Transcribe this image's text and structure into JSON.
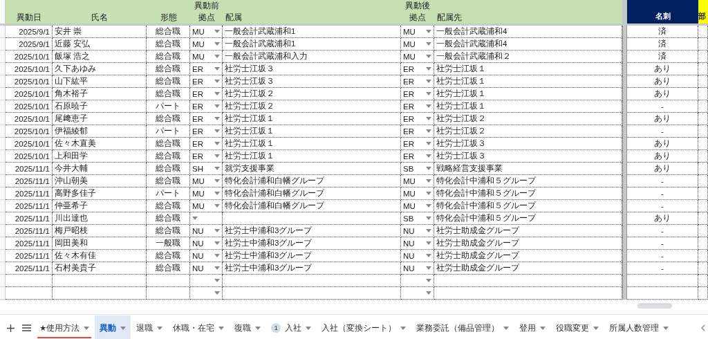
{
  "header": {
    "group_before": "異動前",
    "group_after": "異動後",
    "columns": [
      "異動日",
      "氏名",
      "形態",
      "拠点",
      "配属",
      "拠点",
      "配属先"
    ],
    "card_column": "名刺",
    "cut_column": "部"
  },
  "rows": [
    {
      "date": "2025/9/1",
      "name": "安井 崇",
      "type": "総合職",
      "before_site": "MU",
      "before_dept": "一般会計武蔵浦和1",
      "after_site": "MU",
      "after_dept": "一般会計武蔵浦和4",
      "card": "済"
    },
    {
      "date": "2025/9/1",
      "name": "近藤 安弘",
      "type": "総合職",
      "before_site": "MU",
      "before_dept": "一般会計武蔵浦和1",
      "after_site": "MU",
      "after_dept": "一般会計武蔵浦和4",
      "card": "済"
    },
    {
      "date": "2025/10/1",
      "name": "飯塚 浩之",
      "type": "総合職",
      "before_site": "MU",
      "before_dept": "一般会計武蔵浦和入力",
      "after_site": "MU",
      "after_dept": "一般会計武蔵浦和２",
      "card": "済"
    },
    {
      "date": "2025/10/1",
      "name": "久下あゆみ",
      "type": "総合職",
      "before_site": "ER",
      "before_dept": "社労士江坂３",
      "after_site": "ER",
      "after_dept": "社労士江坂１",
      "card": "あり"
    },
    {
      "date": "2025/10/1",
      "name": "山下紘平",
      "type": "総合職",
      "before_site": "ER",
      "before_dept": "社労士江坂３",
      "after_site": "ER",
      "after_dept": "社労士江坂１",
      "card": "あり"
    },
    {
      "date": "2025/10/1",
      "name": "角木裕子",
      "type": "総合職",
      "before_site": "ER",
      "before_dept": "社労士江坂２",
      "after_site": "ER",
      "after_dept": "社労士江坂１",
      "card": "あり"
    },
    {
      "date": "2025/10/1",
      "name": "石原暁子",
      "type": "パート",
      "before_site": "ER",
      "before_dept": "社労士江坂２",
      "after_site": "ER",
      "after_dept": "社労士江坂１",
      "card": "-"
    },
    {
      "date": "2025/10/1",
      "name": "尾﨑恵子",
      "type": "総合職",
      "before_site": "ER",
      "before_dept": "社労士江坂１",
      "after_site": "ER",
      "after_dept": "社労士江坂２",
      "card": "あり"
    },
    {
      "date": "2025/10/1",
      "name": "伊福綾郁",
      "type": "パート",
      "before_site": "ER",
      "before_dept": "社労士江坂１",
      "after_site": "ER",
      "after_dept": "社労士江坂２",
      "card": "-"
    },
    {
      "date": "2025/10/1",
      "name": "佐々木直美",
      "type": "総合職",
      "before_site": "ER",
      "before_dept": "社労士江坂１",
      "after_site": "ER",
      "after_dept": "社労士江坂３",
      "card": "あり"
    },
    {
      "date": "2025/10/1",
      "name": "上和田学",
      "type": "総合職",
      "before_site": "ER",
      "before_dept": "社労士江坂１",
      "after_site": "ER",
      "after_dept": "社労士江坂３",
      "card": "あり"
    },
    {
      "date": "2025/11/1",
      "name": "今井大輔",
      "type": "総合職",
      "before_site": "SH",
      "before_dept": "就労支援事業",
      "after_site": "SB",
      "after_dept": "戦略経営支援事業",
      "card": "あり"
    },
    {
      "date": "2025/11/1",
      "name": "沖山朝美",
      "type": "総合職",
      "before_site": "MU",
      "before_dept": "特化会計浦和白幡グループ",
      "after_site": "MU",
      "after_dept": "特化会計中浦和５グループ",
      "card": "-"
    },
    {
      "date": "2025/11/1",
      "name": "高野多佳子",
      "type": "パート",
      "before_site": "MU",
      "before_dept": "特化会計浦和白幡グループ",
      "after_site": "MU",
      "after_dept": "特化会計中浦和５グループ",
      "card": "-"
    },
    {
      "date": "2025/11/1",
      "name": "仲亜希子",
      "type": "総合職",
      "before_site": "MU",
      "before_dept": "特化会計浦和白幡グループ",
      "after_site": "MU",
      "after_dept": "特化会計中浦和５グループ",
      "card": "-"
    },
    {
      "date": "2025/11/1",
      "name": "川出達也",
      "type": "総合職",
      "after_site": "SB",
      "after_dept": "特化会計中浦和５グループ",
      "card": "あり"
    },
    {
      "date": "2025/11/1",
      "name": "梅戸昭枝",
      "type": "総合職",
      "before_site": "NU",
      "before_dept": "社労士中浦和3グループ",
      "after_site": "NU",
      "after_dept": "社労士助成金グループ",
      "card": "-"
    },
    {
      "date": "2025/11/1",
      "name": "岡田美和",
      "type": "一般職",
      "before_site": "NU",
      "before_dept": "社労士中浦和3グループ",
      "after_site": "NU",
      "after_dept": "社労士助成金グループ",
      "card": "-"
    },
    {
      "date": "2025/11/1",
      "name": "佐々木有佳",
      "type": "総合職",
      "before_site": "NU",
      "before_dept": "社労士中浦和3グループ",
      "after_site": "NU",
      "after_dept": "社労士助成金グループ",
      "card": "-"
    },
    {
      "date": "2025/11/1",
      "name": "石村美貴子",
      "type": "総合職",
      "before_site": "NU",
      "before_dept": "社労士中浦和3グループ",
      "after_site": "NU",
      "after_dept": "社労士助成金グループ",
      "card": "-"
    }
  ],
  "tabs": [
    {
      "label": "★使用方法",
      "selected": false,
      "color": "#ea4335"
    },
    {
      "label": "異動",
      "selected": true
    },
    {
      "label": "退職",
      "selected": false
    },
    {
      "label": "休職・在宅",
      "selected": false
    },
    {
      "label": "復職",
      "selected": false
    },
    {
      "label": "入社",
      "selected": false,
      "badge": "1"
    },
    {
      "label": "入社（変換シート）",
      "selected": false
    },
    {
      "label": "業務委託（備品管理）",
      "selected": false
    },
    {
      "label": "登用",
      "selected": false
    },
    {
      "label": "役職変更",
      "selected": false
    },
    {
      "label": "所属人数管理",
      "selected": false
    }
  ]
}
